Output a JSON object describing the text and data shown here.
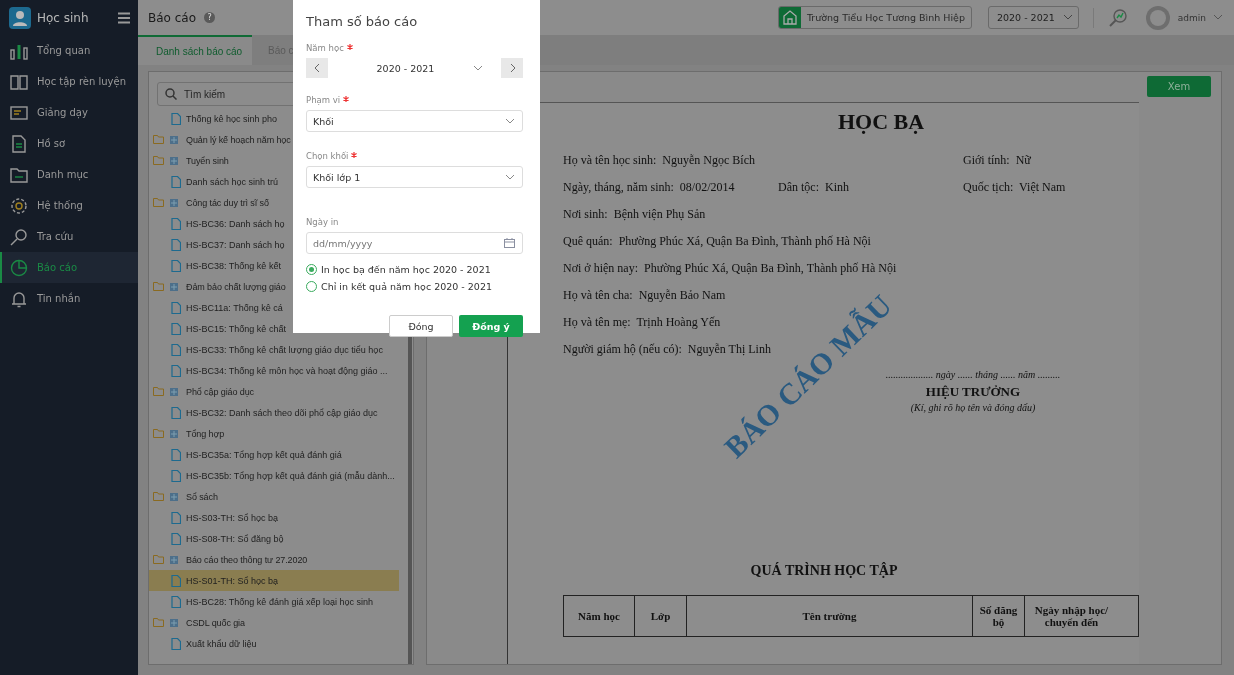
{
  "sidebar": {
    "app_title": "Học sinh",
    "items": [
      {
        "label": "Tổng quan",
        "selected": false
      },
      {
        "label": "Học tập rèn luyện",
        "selected": false
      },
      {
        "label": "Giảng dạy",
        "selected": false
      },
      {
        "label": "Hồ sơ",
        "selected": false
      },
      {
        "label": "Danh mục",
        "selected": false
      },
      {
        "label": "Hệ thống",
        "selected": false
      },
      {
        "label": "Tra cứu",
        "selected": false
      },
      {
        "label": "Báo cáo",
        "selected": true
      },
      {
        "label": "Tin nhắn",
        "selected": false
      }
    ]
  },
  "header": {
    "title": "Báo cáo",
    "help": "?",
    "school": "Trường Tiểu Học Tương Bình Hiệp",
    "year": "2020 - 2021",
    "user": "admin"
  },
  "tabs": [
    {
      "label": "Danh sách báo cáo",
      "selected": true
    },
    {
      "label": "Báo c",
      "selected": false
    }
  ],
  "search": {
    "placeholder": "Tìm kiếm"
  },
  "tree": [
    {
      "kind": "report",
      "label": "Thống kê học sinh pho",
      "selected": false
    },
    {
      "kind": "folder",
      "label": "Quản lý kế hoạch năm học"
    },
    {
      "kind": "folder",
      "label": "Tuyển sinh",
      "children": [
        {
          "label": "Danh sách học sinh trú",
          "selected": false
        }
      ]
    },
    {
      "kind": "folder",
      "label": "Công tác duy trì sĩ số",
      "children": [
        {
          "label": "HS-BC36: Danh sách họ",
          "selected": false
        },
        {
          "label": "HS-BC37: Danh sách họ",
          "selected": false
        },
        {
          "label": "HS-BC38: Thống kê kết",
          "selected": false
        }
      ]
    },
    {
      "kind": "folder",
      "label": "Đảm bảo chất lượng giáo",
      "children": [
        {
          "label": "HS-BC11a: Thống kê cá",
          "selected": false
        },
        {
          "label": "HS-BC15: Thống kê chất",
          "selected": false
        },
        {
          "label": "HS-BC33: Thống kê chất lượng giáo dục tiểu học",
          "selected": false
        },
        {
          "label": "HS-BC34: Thống kê môn học và hoạt động giáo ...",
          "selected": false
        }
      ]
    },
    {
      "kind": "folder",
      "label": "Phổ cập giáo dục",
      "children": [
        {
          "label": "HS-BC32: Danh sách theo dõi phổ cập giáo dục",
          "selected": false
        }
      ]
    },
    {
      "kind": "folder",
      "label": "Tổng hợp",
      "children": [
        {
          "label": "HS-BC35a: Tổng hợp kết quả đánh giá",
          "selected": false
        },
        {
          "label": "HS-BC35b: Tổng hợp kết quả đánh giá (mẫu dành...",
          "selected": false
        }
      ]
    },
    {
      "kind": "folder",
      "label": "Sổ sách",
      "children": [
        {
          "label": "HS-S03-TH: Sổ học bạ",
          "selected": false
        },
        {
          "label": "HS-S08-TH: Sổ đăng bộ",
          "selected": false
        }
      ]
    },
    {
      "kind": "folder",
      "label": "Báo cáo theo thông tư 27.2020",
      "children": [
        {
          "label": "HS-S01-TH: Sổ học bạ",
          "selected": true
        },
        {
          "label": "HS-BC28: Thống kê đánh giá xếp loại học sinh",
          "selected": false
        }
      ]
    },
    {
      "kind": "folder",
      "label": "CSDL quốc gia",
      "children": [
        {
          "label": "Xuất khẩu dữ liệu",
          "selected": false
        }
      ]
    }
  ],
  "view_button": "Xem",
  "document": {
    "title": "HỌC BẠ",
    "rows": [
      [
        {
          "label": "Họ và tên học sinh:",
          "value": "Nguyễn Ngọc Bích"
        },
        null,
        {
          "label": "Giới tính:",
          "value": "Nữ"
        }
      ],
      [
        {
          "label": "Ngày, tháng, năm sinh:",
          "value": "08/02/2014"
        },
        {
          "label": "Dân tộc:",
          "value": "Kinh"
        },
        {
          "label": "Quốc tịch:",
          "value": "Việt Nam"
        }
      ],
      [
        {
          "label": "Nơi sinh:",
          "value": "Bệnh viện Phụ Sản"
        }
      ],
      [
        {
          "label": "Quê quán:",
          "value": "Phường Phúc Xá, Quận Ba Đình, Thành phố Hà Nội"
        }
      ],
      [
        {
          "label": "Nơi ở hiện nay:",
          "value": "Phường Phúc Xá, Quận Ba Đình, Thành phố Hà Nội"
        }
      ],
      [
        {
          "label": "Họ và tên cha:",
          "value": "Nguyễn Bảo Nam"
        }
      ],
      [
        {
          "label": "Họ và tên mẹ:",
          "value": "Trịnh Hoàng Yến"
        }
      ],
      [
        {
          "label": "Người giám hộ (nếu có):",
          "value": "Nguyễn Thị Linh"
        }
      ]
    ],
    "date_line": "................... ngày ...... tháng ...... năm .........",
    "signer": "HIỆU TRƯỞNG",
    "signer_note": "(Kí, ghi rõ họ tên và đóng dấu)",
    "stamp": "BÁO CÁO MẪU",
    "section_title": "QUÁ TRÌNH HỌC TẬP",
    "table_columns": [
      "Năm học",
      "Lớp",
      "Tên trường",
      "Số đăng bộ",
      "Ngày nhập học/ chuyển đến"
    ]
  },
  "dialog": {
    "title": "Tham số báo cáo",
    "fields": [
      {
        "kind": "stepper",
        "label": "Năm học",
        "required": true,
        "value": "2020 - 2021"
      },
      {
        "kind": "select",
        "label": "Phạm vi",
        "required": true,
        "value": "Khối"
      },
      {
        "kind": "select",
        "label": "Chọn khối",
        "required": true,
        "value": "Khối lớp 1"
      },
      {
        "kind": "date",
        "label": "Ngày in",
        "placeholder": "dd/mm/yyyy"
      }
    ],
    "options": [
      {
        "label": "In học bạ đến năm học 2020 - 2021",
        "selected": true
      },
      {
        "label": "Chỉ in kết quả năm học 2020 - 2021",
        "selected": false
      }
    ],
    "buttons": [
      {
        "label": "Đóng",
        "kind": "secondary"
      },
      {
        "label": "Đồng ý",
        "kind": "primary"
      }
    ]
  }
}
